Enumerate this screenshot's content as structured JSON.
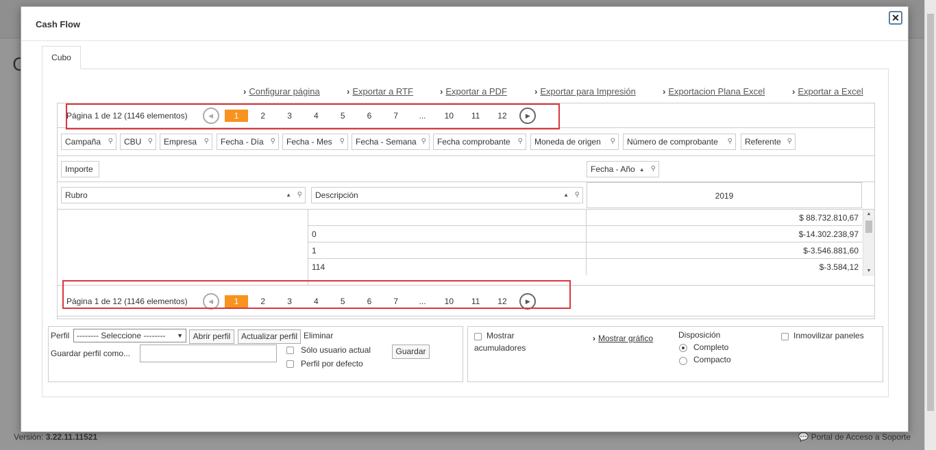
{
  "modal": {
    "title": "Cash Flow",
    "close_label": "✕"
  },
  "tabs": [
    {
      "label": "Cubo"
    }
  ],
  "export_links": [
    "Configurar página",
    "Exportar a RTF",
    "Exportar a PDF",
    "Exportar para Impresión",
    "Exportacion Plana Excel",
    "Exportar a Excel"
  ],
  "pager": {
    "info": "Página 1 de 12 (1146 elementos)",
    "pages": [
      "1",
      "2",
      "3",
      "4",
      "5",
      "6",
      "7",
      "...",
      "10",
      "11",
      "12"
    ],
    "active_page": "1"
  },
  "filter_fields": [
    "Campaña",
    "CBU",
    "Empresa",
    "Fecha - Día",
    "Fecha - Mes",
    "Fecha - Semana",
    "Fecha comprobante",
    "Moneda de origen",
    "Número de comprobante",
    "Referente"
  ],
  "data_field": "Importe",
  "column_field": "Fecha - Año",
  "row_fields": [
    "Rubro",
    "Descripción"
  ],
  "column_header": "2019",
  "grid_rows": [
    {
      "desc": "",
      "value": "$ 88.732.810,67"
    },
    {
      "desc": "0",
      "value": "$-14.302.238,97"
    },
    {
      "desc": "1",
      "value": "$-3.546.881,60"
    },
    {
      "desc": "114",
      "value": "$-3.584,12"
    }
  ],
  "profile": {
    "label": "Perfil",
    "select_value": "-------- Seleccione --------",
    "open_button": "Abrir perfil",
    "update_button": "Actualizar perfil",
    "delete_label": "Eliminar",
    "save_as_label": "Guardar perfil como...",
    "only_user_label": "Sólo usuario actual",
    "default_label": "Perfil por defecto",
    "save_button": "Guardar"
  },
  "options": {
    "show_accum_line1": "Mostrar",
    "show_accum_line2": "acumuladores",
    "show_chart": "Mostrar gráfico",
    "layout_label": "Disposición",
    "layout_complete": "Completo",
    "layout_compact": "Compacto",
    "freeze_panels": "Inmovilizar paneles"
  },
  "footer": {
    "version_label": "Versión:",
    "version_value": "3.22.11.11521",
    "support_link": "Portal de Acceso a Soporte"
  },
  "colors": {
    "accent": "#f7931e",
    "highlight_box": "#d9363e"
  }
}
